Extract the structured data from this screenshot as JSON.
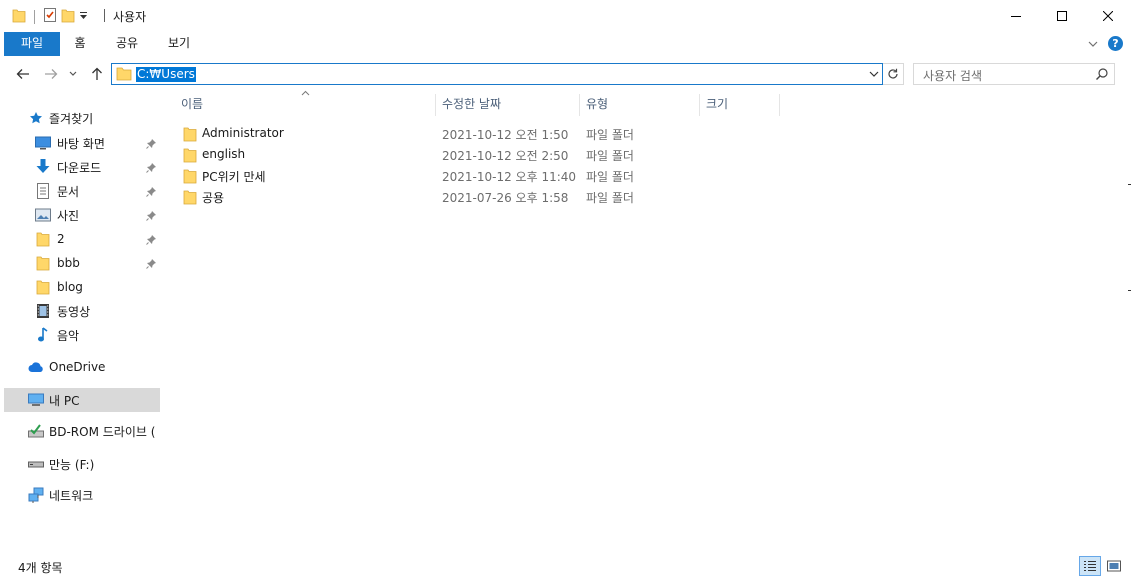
{
  "window": {
    "title": "사용자",
    "minimize_icon": "minimize-icon",
    "maximize_icon": "maximize-icon",
    "close_icon": "close-icon"
  },
  "ribbon": {
    "tabs": [
      {
        "label": "파일",
        "active": true
      },
      {
        "label": "홈"
      },
      {
        "label": "공유"
      },
      {
        "label": "보기"
      }
    ],
    "help_label": "?"
  },
  "address": {
    "path": "C:₩Users",
    "search_placeholder": "사용자 검색"
  },
  "sidebar": {
    "quick_access": "즐겨찾기",
    "items": [
      {
        "label": "바탕 화면",
        "icon": "desktop-icon",
        "pinned": true
      },
      {
        "label": "다운로드",
        "icon": "download-icon",
        "pinned": true
      },
      {
        "label": "문서",
        "icon": "document-icon",
        "pinned": true
      },
      {
        "label": "사진",
        "icon": "picture-icon",
        "pinned": true
      },
      {
        "label": "2",
        "icon": "folder-icon",
        "pinned": true
      },
      {
        "label": "bbb",
        "icon": "folder-icon",
        "pinned": true
      },
      {
        "label": "blog",
        "icon": "folder-icon",
        "pinned": false
      },
      {
        "label": "동영상",
        "icon": "video-icon",
        "pinned": false
      },
      {
        "label": "음악",
        "icon": "music-icon",
        "pinned": false
      }
    ],
    "onedrive": "OneDrive",
    "this_pc": "내 PC",
    "bdrom": "BD-ROM 드라이브 (",
    "drive_f": "만능 (F:)",
    "network": "네트워크"
  },
  "columns": {
    "name": "이름",
    "date": "수정한 날짜",
    "type": "유형",
    "size": "크기"
  },
  "files": [
    {
      "name": "Administrator",
      "date": "2021-10-12 오전 1:50",
      "type": "파일 폴더"
    },
    {
      "name": "english",
      "date": "2021-10-12 오전 2:50",
      "type": "파일 폴더"
    },
    {
      "name": "PC위키 만세",
      "date": "2021-10-12 오후 11:40",
      "type": "파일 폴더"
    },
    {
      "name": "공용",
      "date": "2021-07-26 오후 1:58",
      "type": "파일 폴더"
    }
  ],
  "status": {
    "item_count": "4개 항목"
  },
  "colors": {
    "accent": "#1979ca",
    "selection": "#0078d7",
    "folder": "#ffd769"
  }
}
